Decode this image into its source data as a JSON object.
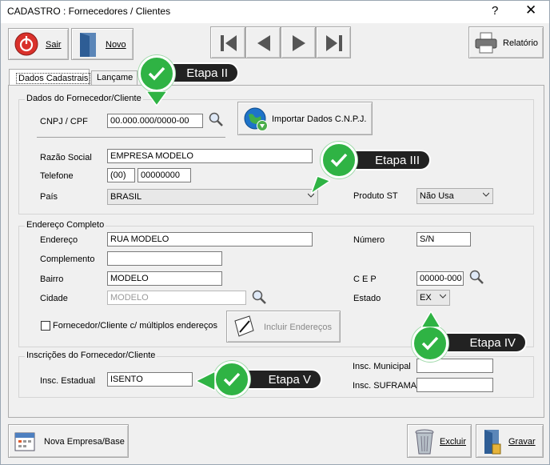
{
  "window": {
    "title": "CADASTRO : Fornecedores / Clientes",
    "help": "?",
    "close": "✕"
  },
  "toolbar": {
    "sair": "Sair",
    "novo": "Novo",
    "relatorio": "Relatório"
  },
  "tabs": {
    "dados": "Dados Cadastrais",
    "lancamentos": "Lançame"
  },
  "fornecedor": {
    "legend": "Dados do Fornecedor/Cliente",
    "cnpj_label": "CNPJ / CPF",
    "cnpj": "00.000.000/0000-00",
    "importar": "Importar Dados C.N.P.J.",
    "razao_label": "Razão Social",
    "razao": "EMPRESA MODELO",
    "telefone_label": "Telefone",
    "ddd": "(00)",
    "telefone": "00000000",
    "pais_label": "País",
    "pais": "BRASIL",
    "produto_st_label": "Produto ST",
    "produto_st": "Não Usa"
  },
  "endereco": {
    "legend": "Endereço Completo",
    "endereco_label": "Endereço",
    "endereco": "RUA MODELO",
    "numero_label": "Número",
    "numero": "S/N",
    "complemento_label": "Complemento",
    "complemento": "",
    "bairro_label": "Bairro",
    "bairro": "MODELO",
    "cep_label": "C E P",
    "cep": "00000-000",
    "cidade_label": "Cidade",
    "cidade": "MODELO",
    "estado_label": "Estado",
    "estado": "EX",
    "multiplos_label": "Fornecedor/Cliente c/ múltiplos endereços",
    "incluir": "Incluir Endereços"
  },
  "inscricoes": {
    "legend": "Inscrições do Fornecedor/Cliente",
    "estadual_label": "Insc. Estadual",
    "estadual": "ISENTO",
    "municipal_label": "Insc. Municipal",
    "municipal": "",
    "suframa_label": "Insc. SUFRAMA",
    "suframa": ""
  },
  "bottom": {
    "nova_empresa": "Nova Empresa/Base",
    "excluir": "Excluir",
    "gravar": "Gravar"
  },
  "callouts": {
    "etapa2": "Etapa II",
    "etapa3": "Etapa III",
    "etapa4": "Etapa IV",
    "etapa5": "Etapa V"
  },
  "colors": {
    "accent_green": "#2fb344",
    "callout_bg": "#222222",
    "sair_red": "#d9312b",
    "globe_blue": "#1e73c8"
  }
}
